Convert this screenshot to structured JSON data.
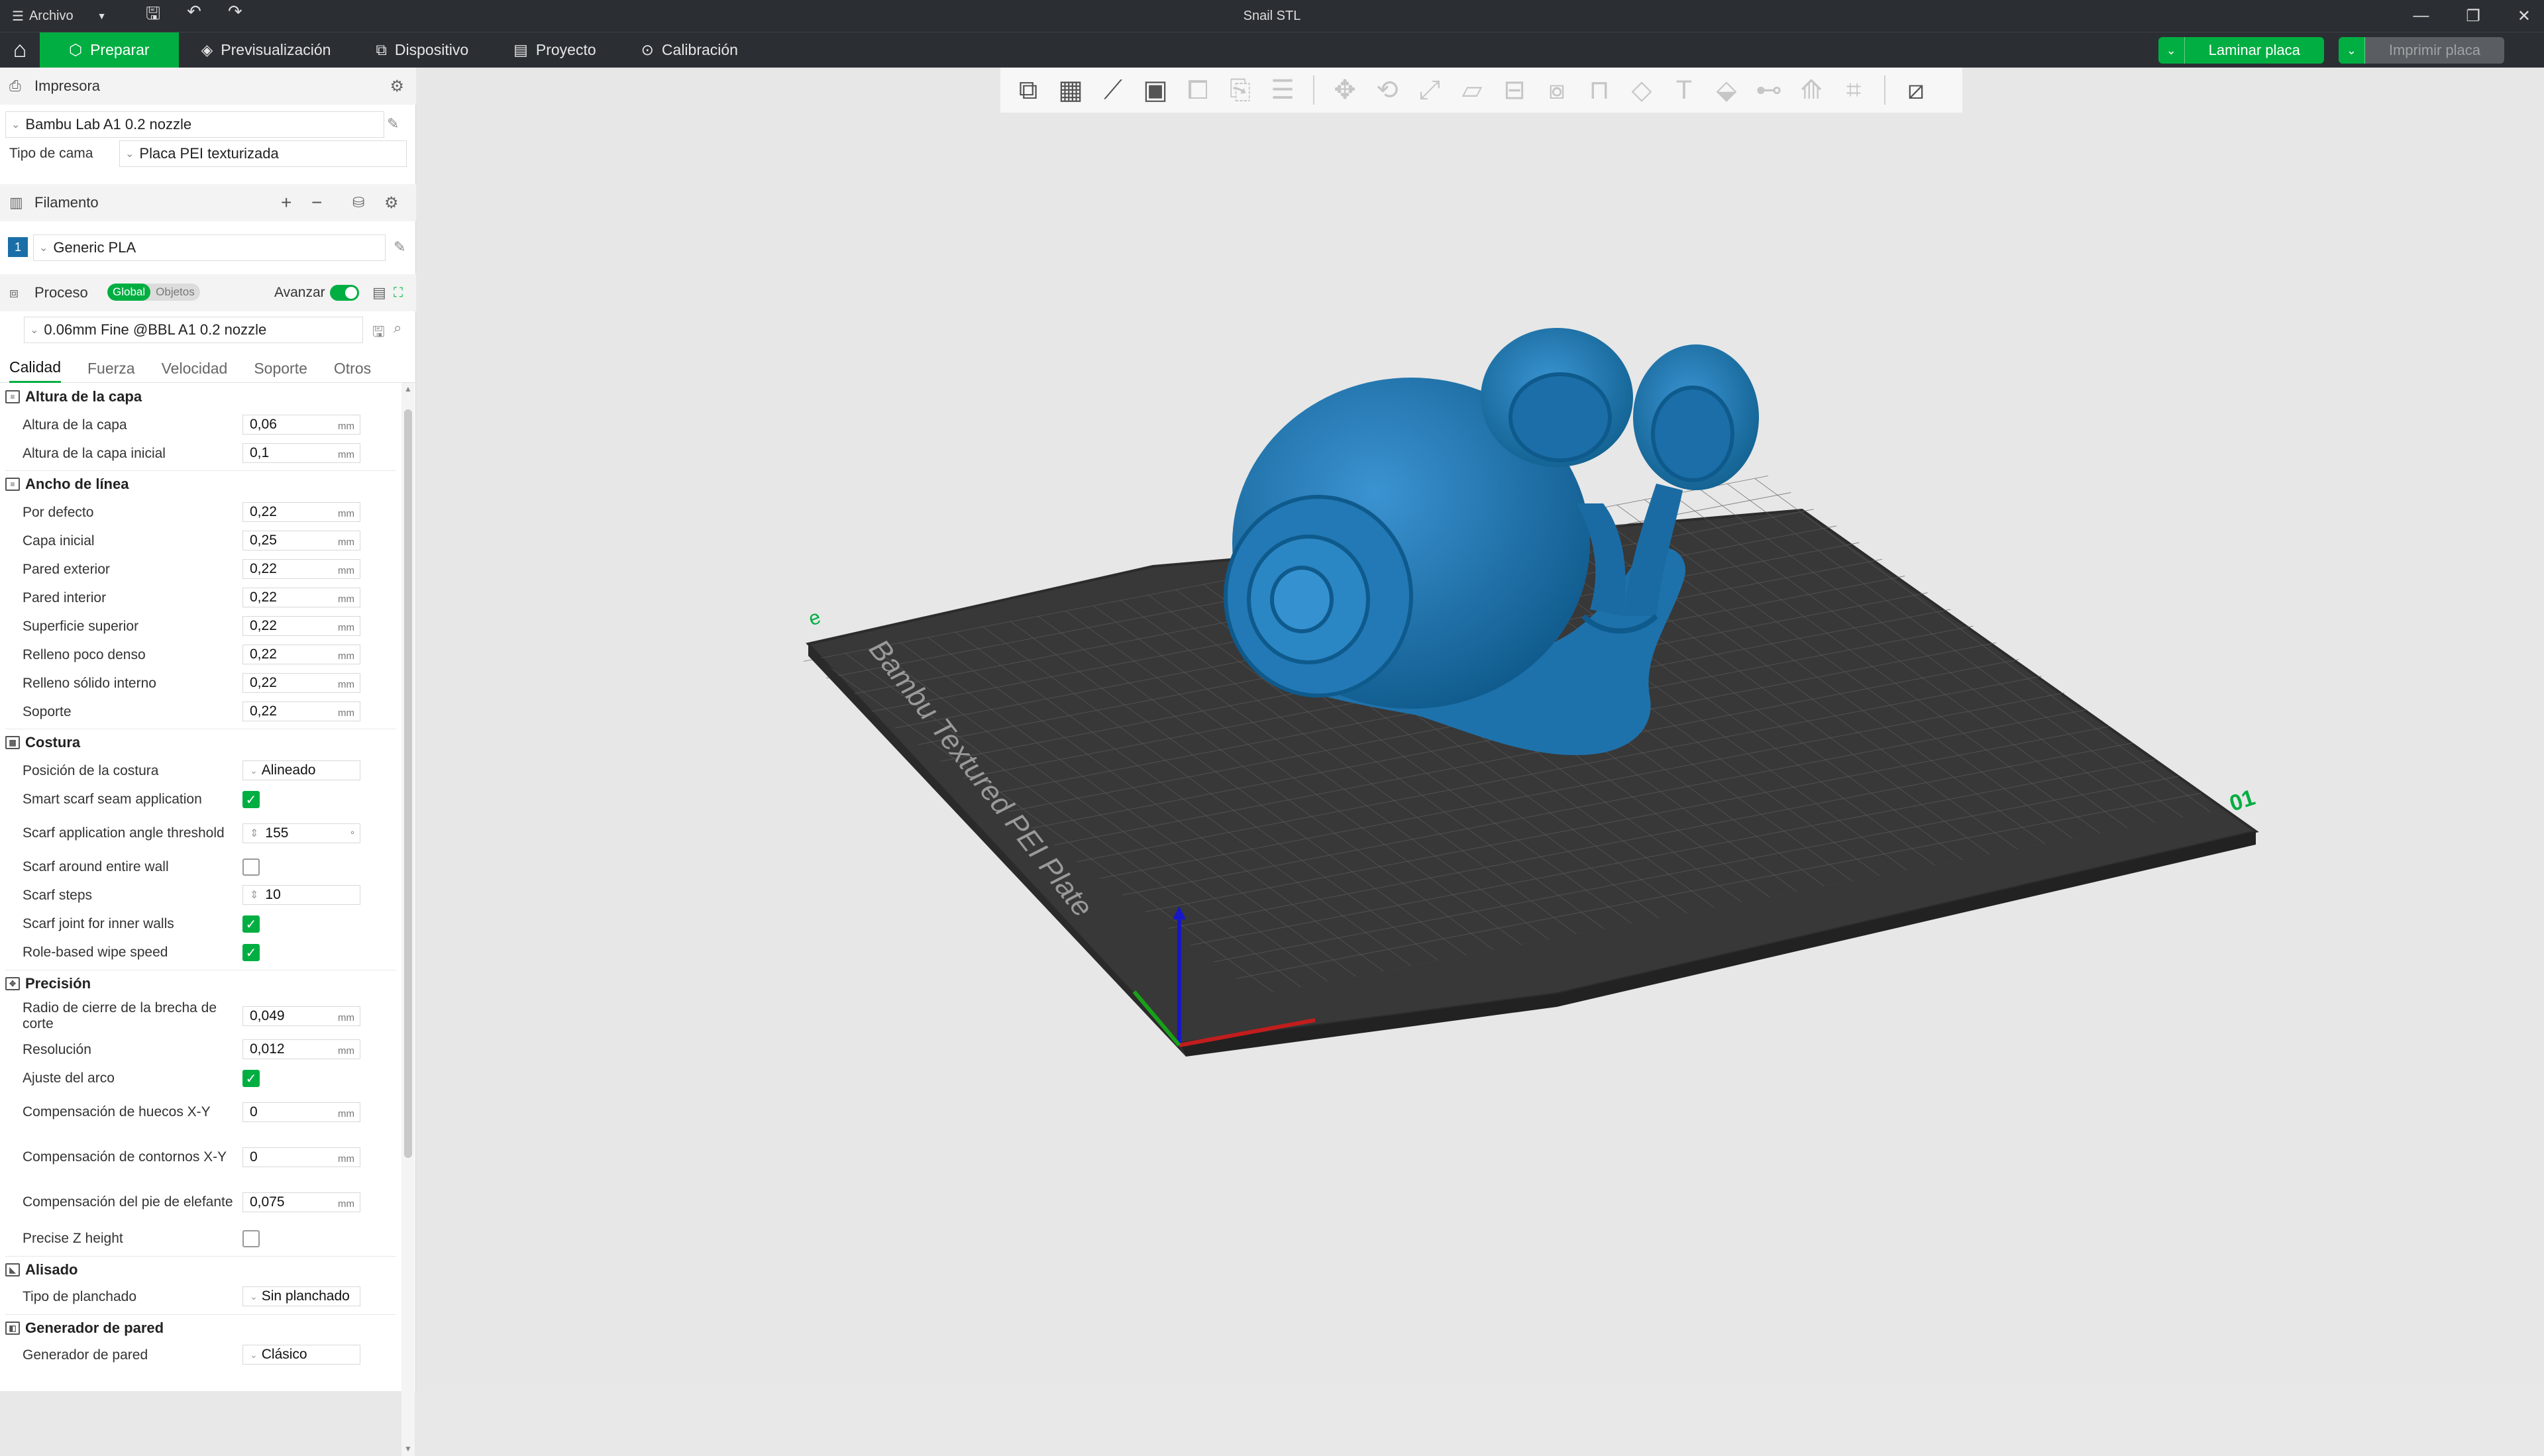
{
  "titlebar": {
    "menu_label": "Archivo",
    "window_title": "Snail STL"
  },
  "nav": {
    "tabs": [
      {
        "label": "Preparar",
        "icon": "cube-icon"
      },
      {
        "label": "Previsualización",
        "icon": "layers-icon"
      },
      {
        "label": "Dispositivo",
        "icon": "device-icon"
      },
      {
        "label": "Proyecto",
        "icon": "project-icon"
      },
      {
        "label": "Calibración",
        "icon": "calibration-icon"
      }
    ],
    "slice_button": "Laminar placa",
    "print_button": "Imprimir placa"
  },
  "printer": {
    "section_label": "Impresora",
    "printer_name": "Bambu Lab A1 0.2 nozzle",
    "bed_type_label": "Tipo de cama",
    "bed_type_value": "Placa PEI texturizada"
  },
  "filament": {
    "section_label": "Filamento",
    "slot_number": "1",
    "filament_name": "Generic PLA"
  },
  "process": {
    "section_label": "Proceso",
    "toggle_global": "Global",
    "toggle_objects": "Objetos",
    "advanced_label": "Avanzar",
    "preset": "0.06mm Fine @BBL A1 0.2 nozzle"
  },
  "subtabs": [
    "Calidad",
    "Fuerza",
    "Velocidad",
    "Soporte",
    "Otros"
  ],
  "groups": {
    "layer_height": "Altura de la capa",
    "line_width": "Ancho de línea",
    "seam": "Costura",
    "precision": "Precisión",
    "ironing": "Alisado",
    "wall_generator": "Generador de pared"
  },
  "params": {
    "layer_height": {
      "label": "Altura de la capa",
      "value": "0,06",
      "unit": "mm"
    },
    "initial_layer_height": {
      "label": "Altura de la capa inicial",
      "value": "0,1",
      "unit": "mm"
    },
    "lw_default": {
      "label": "Por defecto",
      "value": "0,22",
      "unit": "mm"
    },
    "lw_initial": {
      "label": "Capa inicial",
      "value": "0,25",
      "unit": "mm"
    },
    "lw_outer": {
      "label": "Pared exterior",
      "value": "0,22",
      "unit": "mm"
    },
    "lw_inner": {
      "label": "Pared interior",
      "value": "0,22",
      "unit": "mm"
    },
    "lw_top": {
      "label": "Superficie superior",
      "value": "0,22",
      "unit": "mm"
    },
    "lw_sparse": {
      "label": "Relleno poco denso",
      "value": "0,22",
      "unit": "mm"
    },
    "lw_solid": {
      "label": "Relleno sólido interno",
      "value": "0,22",
      "unit": "mm"
    },
    "lw_support": {
      "label": "Soporte",
      "value": "0,22",
      "unit": "mm"
    },
    "seam_position": {
      "label": "Posición de la costura",
      "value": "Alineado"
    },
    "smart_scarf": {
      "label": "Smart scarf seam application",
      "checked": true
    },
    "scarf_angle": {
      "label": "Scarf application angle threshold",
      "value": "155",
      "unit": "°"
    },
    "scarf_entire": {
      "label": "Scarf around entire wall",
      "checked": false
    },
    "scarf_steps": {
      "label": "Scarf steps",
      "value": "10"
    },
    "scarf_inner": {
      "label": "Scarf joint for inner walls",
      "checked": true
    },
    "role_wipe": {
      "label": "Role-based wipe speed",
      "checked": true
    },
    "slice_gap": {
      "label": "Radio de cierre de la brecha de corte",
      "value": "0,049",
      "unit": "mm"
    },
    "resolution": {
      "label": "Resolución",
      "value": "0,012",
      "unit": "mm"
    },
    "arc_fitting": {
      "label": "Ajuste del arco",
      "checked": true
    },
    "xy_hole": {
      "label": "Compensación de huecos X-Y",
      "value": "0",
      "unit": "mm"
    },
    "xy_contour": {
      "label": "Compensación de contornos X-Y",
      "value": "0",
      "unit": "mm"
    },
    "elephant_foot": {
      "label": "Compensación del pie de elefante",
      "value": "0,075",
      "unit": "mm"
    },
    "precise_z": {
      "label": "Precise Z height",
      "checked": false
    },
    "ironing_type": {
      "label": "Tipo de planchado",
      "value": "Sin planchado"
    },
    "wall_generator": {
      "label": "Generador de pared",
      "value": "Clásico"
    }
  },
  "viewport": {
    "plate_text": "Bambu Textured PEI Plate",
    "plate_number": "01",
    "model_color": "#1a6fa8",
    "bed_color": "#3a3a3a",
    "accent_color": "#00ae42"
  }
}
